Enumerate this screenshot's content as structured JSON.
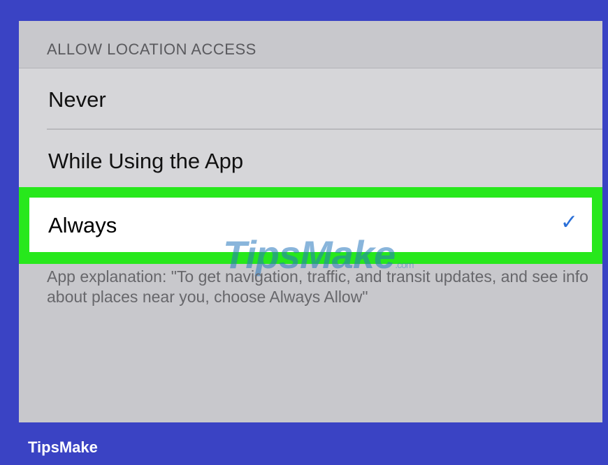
{
  "settings": {
    "section_header": "ALLOW LOCATION ACCESS",
    "options": [
      {
        "label": "Never",
        "selected": false
      },
      {
        "label": "While Using the App",
        "selected": false
      },
      {
        "label": "Always",
        "selected": true
      }
    ],
    "checkmark": "✓",
    "explanation": "App explanation: \"To get navigation, traffic, and transit updates, and see info about places near you, choose Always Allow\""
  },
  "watermark": {
    "main": "TipsMake",
    "suffix": ".com"
  },
  "footer": {
    "brand": "TipsMake"
  },
  "colors": {
    "background": "#3a43c4",
    "highlight": "#27e81c",
    "checkmark": "#2a6fd8"
  }
}
